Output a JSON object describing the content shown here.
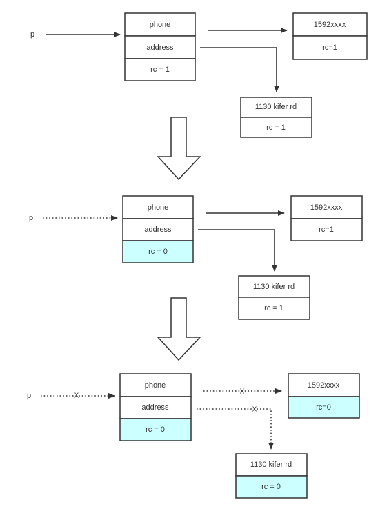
{
  "colors": {
    "line": "#333333",
    "highlight": "#ccffff"
  },
  "panels": [
    {
      "pointer": "p",
      "pointer_style": "solid",
      "object": {
        "fields": [
          "phone",
          "address"
        ],
        "rc": "rc = 1",
        "rc_highlight": false
      },
      "phone_obj": {
        "value": "1592xxxx",
        "rc": "rc=1",
        "rc_highlight": false
      },
      "address_obj": {
        "value": "1130 kifer rd",
        "rc": "rc = 1",
        "rc_highlight": false
      }
    },
    {
      "pointer": "p",
      "pointer_style": "dotted",
      "object": {
        "fields": [
          "phone",
          "address"
        ],
        "rc": "rc = 0",
        "rc_highlight": true
      },
      "phone_obj": {
        "value": "1592xxxx",
        "rc": "rc=1",
        "rc_highlight": false
      },
      "address_obj": {
        "value": "1130 kifer rd",
        "rc": "rc = 1",
        "rc_highlight": false
      }
    },
    {
      "pointer": "p",
      "pointer_style": "dotted-cut",
      "cut_mark": "X",
      "object": {
        "fields": [
          "phone",
          "address"
        ],
        "rc": "rc = 0",
        "rc_highlight": true
      },
      "phone_obj": {
        "value": "1592xxxx",
        "rc": "rc=0",
        "rc_highlight": true
      },
      "address_obj": {
        "value": "1130 kifer rd",
        "rc": "rc = 0",
        "rc_highlight": true
      }
    }
  ]
}
